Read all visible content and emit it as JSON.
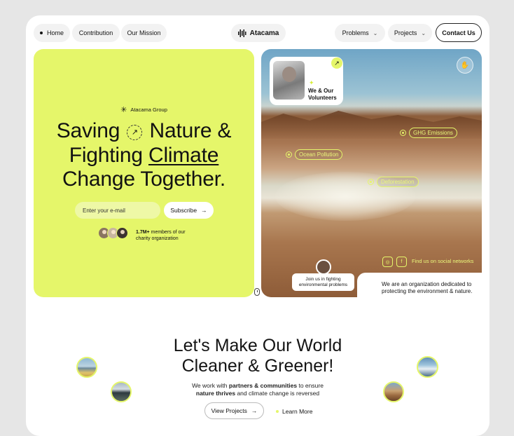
{
  "nav": {
    "home": "Home",
    "contribution": "Contribution",
    "mission": "Our Mission",
    "logo": "Atacama",
    "problems": "Problems",
    "projects": "Projects",
    "contact": "Contact Us"
  },
  "hero": {
    "group": "Atacama Group",
    "headline_1": "Saving",
    "headline_2": "Nature &",
    "headline_3": "Fighting",
    "headline_4": "Climate",
    "headline_5": "Change Together.",
    "email_placeholder": "Enter your e-mail",
    "subscribe": "Subscribe",
    "members_count": "1.7M+",
    "members_text_1": "members of our",
    "members_text_2": "charity organization"
  },
  "visual": {
    "volunteers_1": "We & Our",
    "volunteers_2": "Volunteers",
    "tags": [
      "GHG Emissions",
      "Ocean Pollution",
      "Deforestation"
    ],
    "social_text": "Find us on social networks",
    "join_1": "Join us in fighting",
    "join_2": "environmental problems",
    "about_1": "We are an organization dedicated to",
    "about_2": "protecting the environment & nature."
  },
  "section": {
    "title_1": "Let's Make Our World",
    "title_2": "Cleaner & Greener!",
    "sub_pre": "We work with ",
    "sub_b1": "partners & communities",
    "sub_mid": " to ensure",
    "sub_b2": "nature thrives",
    "sub_post": " and climate change is reversed",
    "view_projects": "View Projects",
    "learn_more": "Learn More"
  },
  "colors": {
    "accent": "#e5f66a",
    "ink": "#141414",
    "background": "#e6e6e6"
  }
}
